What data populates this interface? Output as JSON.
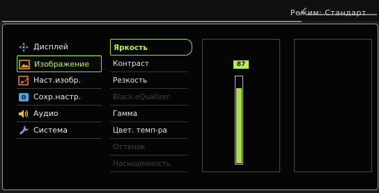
{
  "header": {
    "mode": "Режим: Стандарт"
  },
  "menu": [
    {
      "label": "Дисплей",
      "icon": "display-icon"
    },
    {
      "label": "Изображение",
      "icon": "picture-icon"
    },
    {
      "label": "Наст.изобр.",
      "icon": "picture-settings-icon"
    },
    {
      "label": "Сохр.настр.",
      "icon": "save-settings-icon"
    },
    {
      "label": "Аудио",
      "icon": "speaker-icon"
    },
    {
      "label": "Система",
      "icon": "wrench-icon"
    }
  ],
  "submenu": [
    {
      "label": "Яркость"
    },
    {
      "label": "Контраст"
    },
    {
      "label": "Резкость"
    },
    {
      "label": "Black eQualizer"
    },
    {
      "label": "Гамма"
    },
    {
      "label": "Цвет. темп-ра"
    },
    {
      "label": "Оттенок"
    },
    {
      "label": "Насыщенность"
    }
  ],
  "brightness": {
    "value": "87",
    "level": 0.87
  },
  "colors": {
    "accent": "#b6f04a",
    "bar": "#a9df3d"
  }
}
